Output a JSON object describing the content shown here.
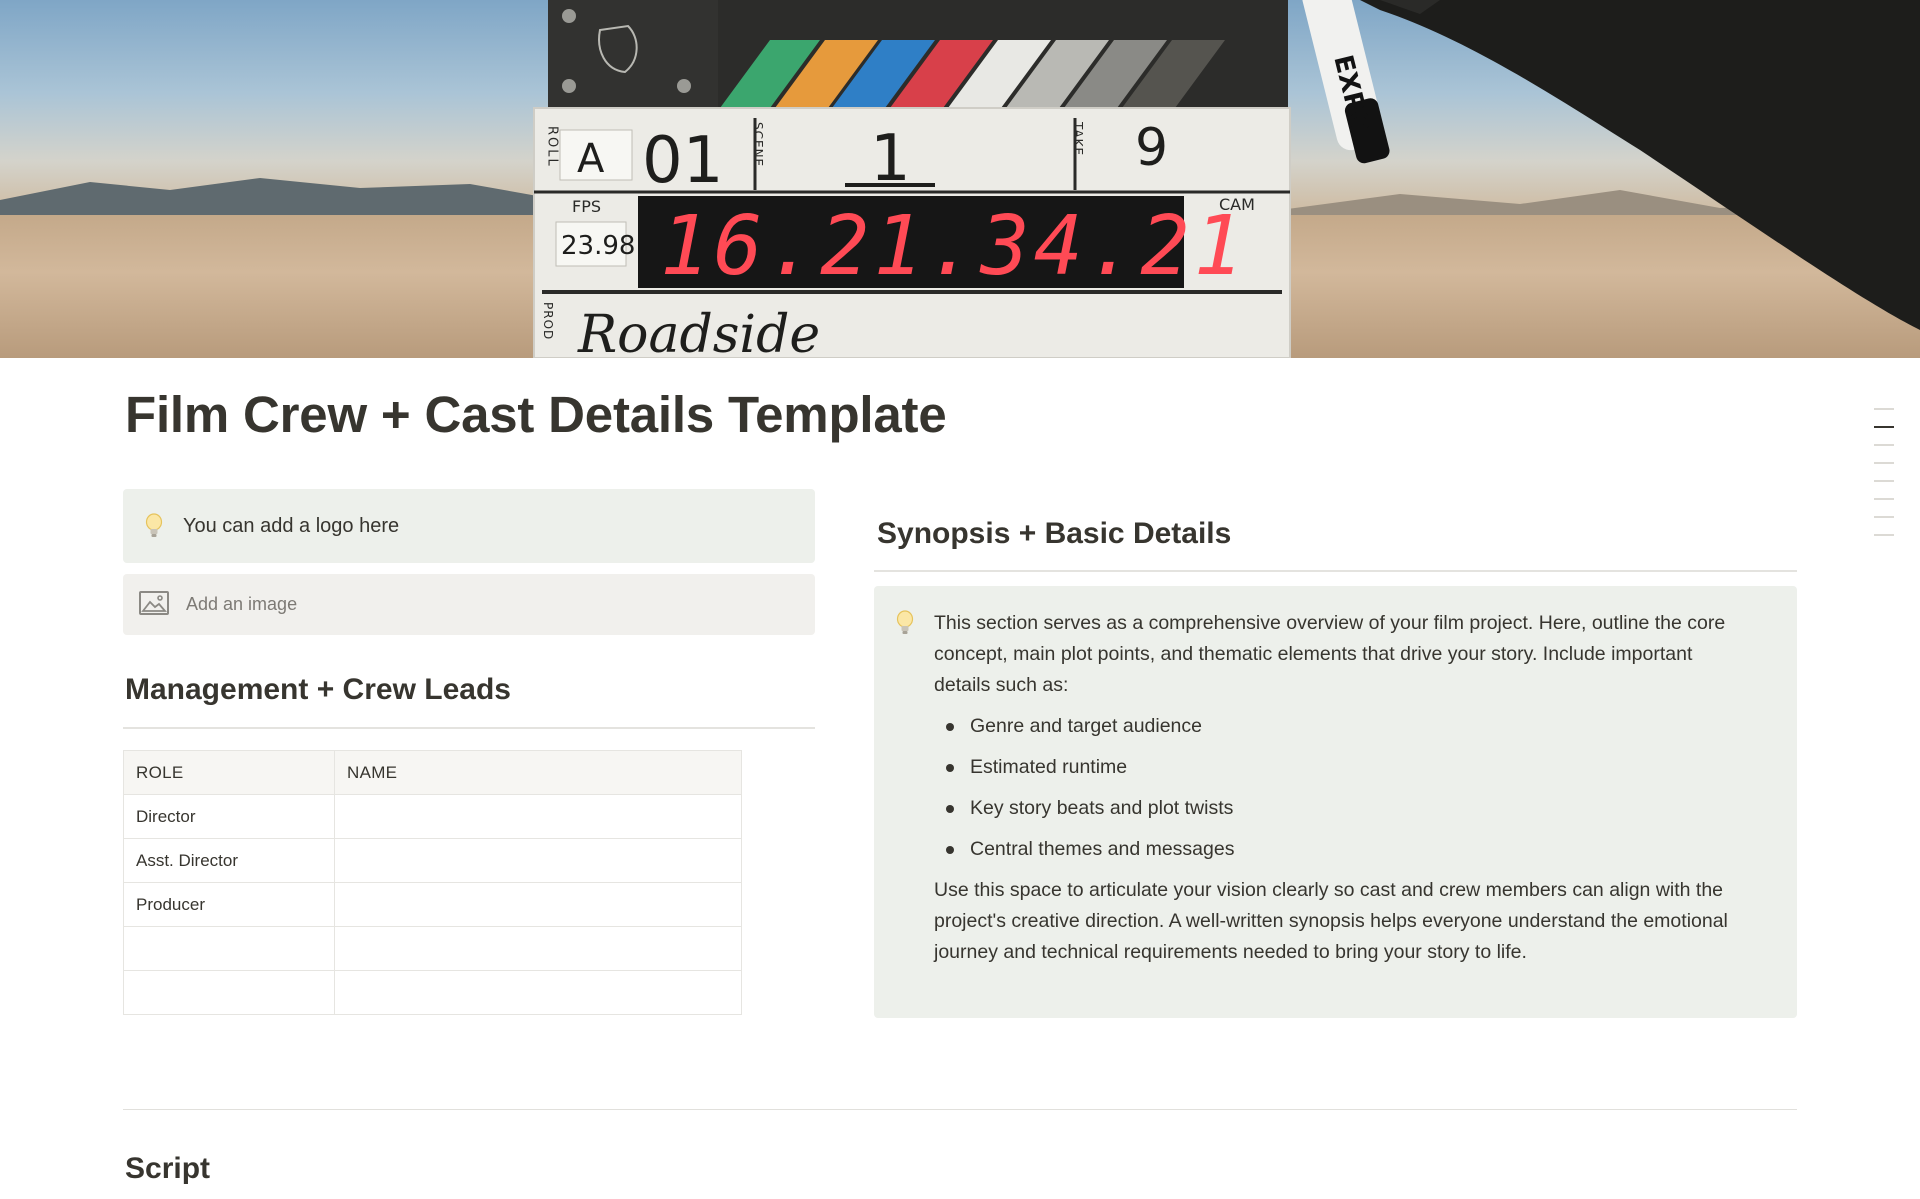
{
  "cover": {
    "alt": "Film clapperboard in the desert",
    "slate": {
      "roll_label": "ROLL",
      "roll": "A",
      "scene_label": "SCENE",
      "scene_number": "01",
      "scene": "1",
      "take_label": "TAKE",
      "take": "9",
      "fps_label": "FPS",
      "fps": "23.98",
      "timecode": "16.21.34.21",
      "cam_label": "CAM",
      "prod_label": "PROD",
      "production": "Roadside",
      "marker_brand": "EXPO"
    }
  },
  "page": {
    "title": "Film Crew + Cast Details Template"
  },
  "logo_callout": {
    "icon": "lightbulb-icon",
    "text": "You can add a logo here"
  },
  "image_placeholder": {
    "icon": "image-icon",
    "label": "Add an image"
  },
  "management": {
    "heading": "Management + Crew Leads",
    "columns": [
      "ROLE",
      "NAME"
    ],
    "rows": [
      {
        "role": "Director",
        "name": ""
      },
      {
        "role": "Asst. Director",
        "name": ""
      },
      {
        "role": "Producer",
        "name": ""
      },
      {
        "role": "",
        "name": ""
      },
      {
        "role": "",
        "name": ""
      }
    ]
  },
  "synopsis": {
    "heading": "Synopsis + Basic Details",
    "icon": "lightbulb-icon",
    "intro": "This section serves as a comprehensive overview of your film project. Here, outline the core concept, main plot points, and thematic elements that drive your story. Include important details such as:",
    "bullets": [
      "Genre and target audience",
      "Estimated runtime",
      "Key story beats and plot twists",
      "Central themes and messages"
    ],
    "outro": "Use this space to articulate your vision clearly so cast and crew members can align with the project's creative direction. A well-written synopsis helps everyone understand the emotional journey and technical requirements needed to bring your story to life."
  },
  "script": {
    "heading": "Script"
  },
  "outline": {
    "items": 8,
    "active_index": 1
  },
  "colors": {
    "text": "#37352f",
    "callout_bg": "#edf0eb",
    "placeholder_bg": "#f1f0ed",
    "timecode_red": "#ff4a55"
  }
}
